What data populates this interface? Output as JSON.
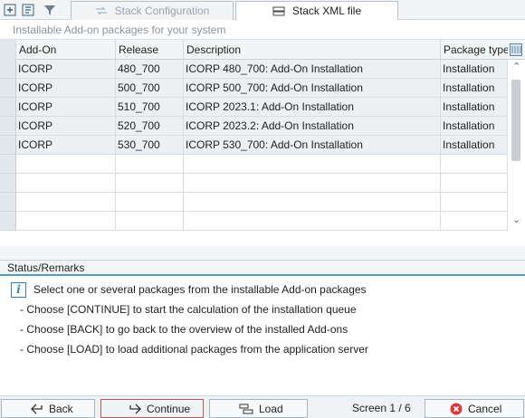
{
  "toolbar": {
    "tabs": [
      {
        "label": "Stack Configuration",
        "state": "disabled"
      },
      {
        "label": "Stack XML file",
        "state": "active"
      }
    ]
  },
  "subtitle": "Installable Add-on packages for your system",
  "table": {
    "columns": [
      "Add-On",
      "Release",
      "Description",
      "Package type"
    ],
    "rows": [
      {
        "addon": "ICORP",
        "release": "480_700",
        "description": "ICORP 480_700: Add-On Installation",
        "type": "Installation"
      },
      {
        "addon": "ICORP",
        "release": "500_700",
        "description": "ICORP 500_700: Add-On Installation",
        "type": "Installation"
      },
      {
        "addon": "ICORP",
        "release": "510_700",
        "description": "ICORP 2023.1: Add-On Installation",
        "type": "Installation"
      },
      {
        "addon": "ICORP",
        "release": "520_700",
        "description": "ICORP 2023.2: Add-On Installation",
        "type": "Installation"
      },
      {
        "addon": "ICORP",
        "release": "530_700",
        "description": "ICORP 530_700: Add-On Installation",
        "type": "Installation"
      }
    ]
  },
  "status": {
    "title": "Status/Remarks",
    "lines": [
      "Select one or several packages from the installable Add-on packages",
      "- Choose [CONTINUE] to start the calculation of the installation queue",
      "- Choose [BACK] to go back to the overview of the installed Add-ons",
      "- Choose [LOAD] to load additional packages from the application server"
    ]
  },
  "footer": {
    "back": "Back",
    "continue": "Continue",
    "load": "Load",
    "screen": "Screen 1 / 6",
    "cancel": "Cancel"
  },
  "colors": {
    "accent": "#4f9bd2",
    "cancel_red": "#d93a3a",
    "selection_gray": "#ecf0f3"
  }
}
